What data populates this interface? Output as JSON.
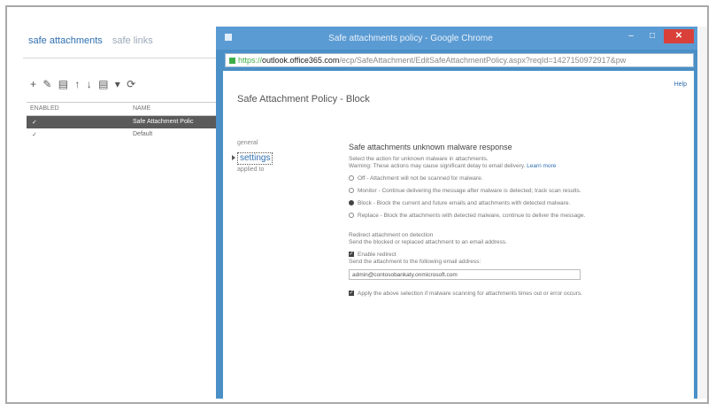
{
  "background": {
    "tabs": [
      "safe attachments",
      "safe links"
    ],
    "toolbar_icons": [
      "plus-icon",
      "edit-icon",
      "delete-icon",
      "up-icon",
      "down-icon",
      "copy-icon",
      "refresh-icon"
    ],
    "toolbar_text": "+ ✎ ▤ ↑ ↓ ▤ ▾ ⟳",
    "columns": [
      "ENABLED",
      "NAME"
    ],
    "rows": [
      {
        "enabled": "✓",
        "name": "Safe Attachment Polic",
        "selected": true
      },
      {
        "enabled": "✓",
        "name": "Default",
        "selected": false
      }
    ]
  },
  "window": {
    "title": "Safe attachments policy - Google Chrome",
    "url_https": "https://",
    "url_host": "outlook.office365.com",
    "url_path": "/ecp/SafeAttachment/EditSafeAttachmentPolicy.aspx?reqId=1427150972917&pw",
    "buttons": {
      "minimize": "–",
      "maximize": "□",
      "close": "✕"
    }
  },
  "page": {
    "help": "Help",
    "title": "Safe Attachment Policy - Block",
    "nav": [
      "general",
      "settings",
      "applied to"
    ],
    "active_nav": "settings",
    "heading": "Safe attachments unknown malware response",
    "description": "Select the action for unknown malware in attachments.",
    "warning": "Warning: These actions may cause significant delay to email delivery.",
    "learn_more": "Learn more",
    "options": [
      {
        "label": "Off - Attachment will not be scanned for malware.",
        "selected": false
      },
      {
        "label": "Monitor - Continue delivering the message after malware is detected; track scan results.",
        "selected": false
      },
      {
        "label": "Block - Block the current and future emails and attachments with detected malware.",
        "selected": true
      },
      {
        "label": "Replace - Block the attachments with detected malware, continue to deliver the message.",
        "selected": false
      }
    ],
    "redirect_heading": "Redirect attachment on detection",
    "redirect_desc": "Send the blocked or replaced attachment to an email address.",
    "enable_redirect": "Enable redirect",
    "send_to_label": "Send the attachment to the following email address:",
    "email_value": "admin@contosobankaty.onmicrosoft.com",
    "apply_option": "Apply the above selection if malware scanning for attachments times out or error occurs."
  }
}
